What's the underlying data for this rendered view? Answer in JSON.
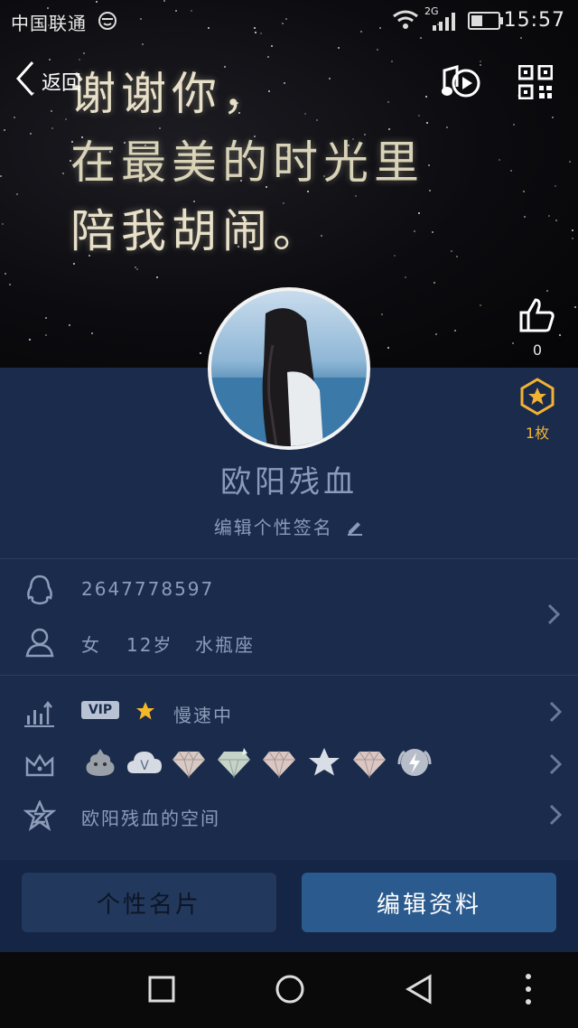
{
  "status_bar": {
    "carrier": "中国联通",
    "network": "2G",
    "time": "15:57"
  },
  "header": {
    "back_label": "返回",
    "banner_lines": [
      "谢谢你，",
      "在最美的时光里",
      "陪我胡闹。"
    ],
    "like_count": "0",
    "medal_count": "1枚"
  },
  "profile": {
    "nickname": "欧阳残血",
    "signature_placeholder": "编辑个性签名"
  },
  "info": {
    "qq_number": "2647778597",
    "gender": "女",
    "age": "12岁",
    "zodiac": "水瓶座"
  },
  "level": {
    "vip_label": "VIP",
    "speed_text": "慢速中"
  },
  "space": {
    "label": "欧阳残血的空间"
  },
  "actions": {
    "card_label": "个性名片",
    "edit_label": "编辑资料"
  },
  "colors": {
    "background": "#1a2b4c",
    "accent": "#2a5a8e",
    "medal": "#f2b233"
  }
}
